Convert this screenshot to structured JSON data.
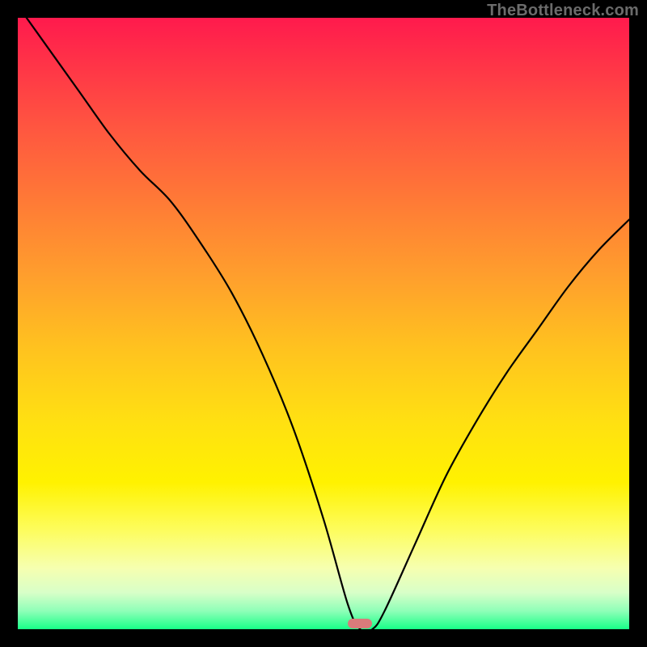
{
  "watermark": "TheBottleneck.com",
  "colors": {
    "frame": "#000000",
    "marker": "#d97b7b",
    "curve": "#000000"
  },
  "chart_data": {
    "type": "line",
    "title": "",
    "xlabel": "",
    "ylabel": "",
    "xlim": [
      0,
      100
    ],
    "ylim": [
      0,
      100
    ],
    "grid": false,
    "legend": false,
    "x": [
      0,
      5,
      10,
      15,
      20,
      25,
      30,
      35,
      40,
      45,
      50,
      54,
      56,
      58,
      60,
      65,
      70,
      75,
      80,
      85,
      90,
      95,
      100
    ],
    "values": [
      102,
      95,
      88,
      81,
      75,
      70,
      63,
      55,
      45,
      33,
      18,
      4,
      0,
      0,
      3,
      14,
      25,
      34,
      42,
      49,
      56,
      62,
      67
    ],
    "marker": {
      "x_start": 54,
      "x_end": 58,
      "y": 0
    }
  }
}
